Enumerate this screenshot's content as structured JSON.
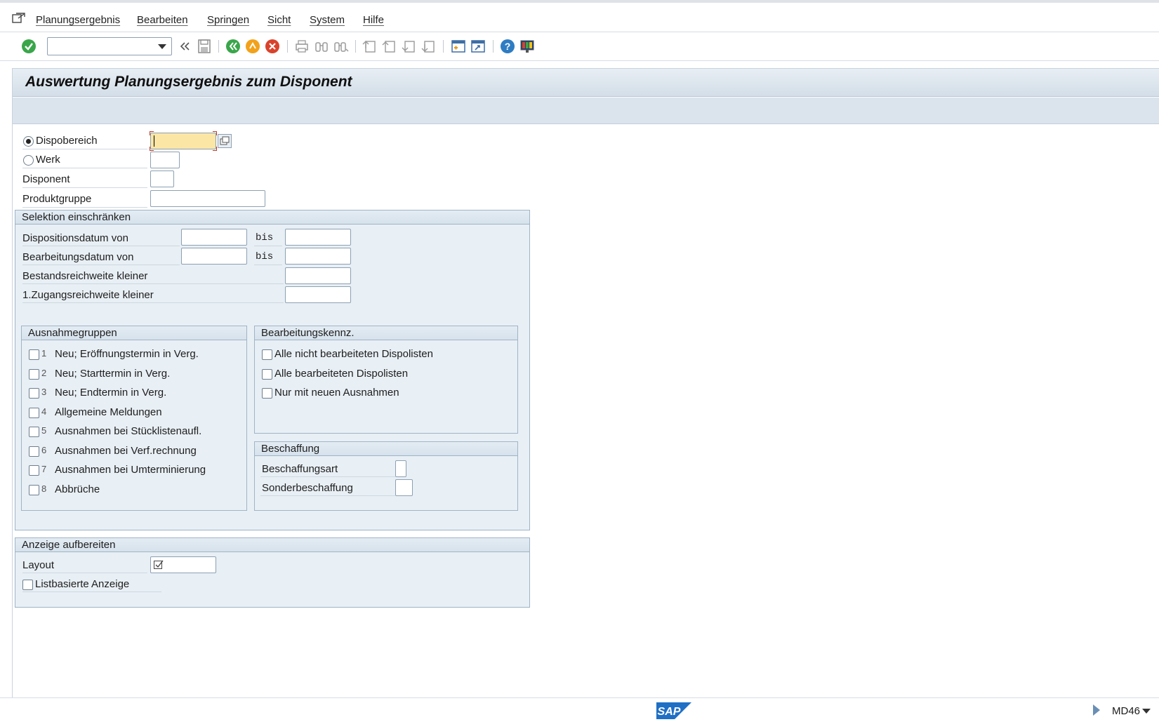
{
  "menubar": {
    "items": [
      "Planungsergebnis",
      "Bearbeiten",
      "Springen",
      "Sicht",
      "System",
      "Hilfe"
    ]
  },
  "toolbar": {
    "command_field_value": "",
    "icons": [
      "enter-icon",
      "back-double-icon",
      "save-icon",
      "back-icon",
      "exit-icon",
      "cancel-icon",
      "print-icon",
      "find-icon",
      "find-next-icon",
      "first-page-icon",
      "previous-page-icon",
      "next-page-icon",
      "last-page-icon",
      "create-session-icon",
      "generate-shortcut-icon",
      "help-icon",
      "customize-layout-icon"
    ]
  },
  "page": {
    "title": "Auswertung Planungsergebnis zum Disponent"
  },
  "form": {
    "dispobereich": {
      "label": "Dispobereich",
      "value": "",
      "selected": true
    },
    "werk": {
      "label": "Werk",
      "value": "",
      "selected": false
    },
    "disponent": {
      "label": "Disponent",
      "value": ""
    },
    "produktgruppe": {
      "label": "Produktgruppe",
      "value": ""
    }
  },
  "selektion": {
    "title": "Selektion einschränken",
    "dispositionsdatum": {
      "label": "Dispositionsdatum von",
      "from": "",
      "to_label": "bis",
      "to": ""
    },
    "bearbeitungsdatum": {
      "label": "Bearbeitungsdatum von",
      "from": "",
      "to_label": "bis",
      "to": ""
    },
    "bestandsreichweite": {
      "label": "Bestandsreichweite kleiner",
      "value": ""
    },
    "zugangsreichweite": {
      "label": "1.Zugangsreichweite kleiner",
      "value": ""
    }
  },
  "ausnahmegruppen": {
    "title": "Ausnahmegruppen",
    "items": [
      {
        "num": "1",
        "label": "Neu; Eröffnungstermin in Verg.",
        "checked": false
      },
      {
        "num": "2",
        "label": "Neu; Starttermin in Verg.",
        "checked": false
      },
      {
        "num": "3",
        "label": "Neu; Endtermin in Verg.",
        "checked": false
      },
      {
        "num": "4",
        "label": "Allgemeine Meldungen",
        "checked": false
      },
      {
        "num": "5",
        "label": "Ausnahmen bei Stücklistenaufl.",
        "checked": false
      },
      {
        "num": "6",
        "label": "Ausnahmen bei Verf.rechnung",
        "checked": false
      },
      {
        "num": "7",
        "label": "Ausnahmen bei Umterminierung",
        "checked": false
      },
      {
        "num": "8",
        "label": "Abbrüche",
        "checked": false
      }
    ]
  },
  "bearbeitungskennz": {
    "title": "Bearbeitungskennz.",
    "items": [
      {
        "label": "Alle nicht bearbeiteten Dispolisten",
        "checked": false
      },
      {
        "label": "Alle bearbeiteten Dispolisten",
        "checked": false
      },
      {
        "label": "Nur mit neuen Ausnahmen",
        "checked": false
      }
    ]
  },
  "beschaffung": {
    "title": "Beschaffung",
    "beschaffungsart": {
      "label": "Beschaffungsart",
      "value": ""
    },
    "sonderbeschaffung": {
      "label": "Sonderbeschaffung",
      "value": ""
    }
  },
  "anzeige": {
    "title": "Anzeige aufbereiten",
    "layout": {
      "label": "Layout",
      "value": ""
    },
    "listbasiert": {
      "label": "Listbasierte Anzeige",
      "checked": false
    }
  },
  "statusbar": {
    "logo": "SAP",
    "transaction": "MD46"
  },
  "colors": {
    "active_field": "#fbe6a5",
    "group_bg": "#e8eff5",
    "title_bar": "#d3dee8",
    "sap_blue": "#1f6fc5"
  }
}
